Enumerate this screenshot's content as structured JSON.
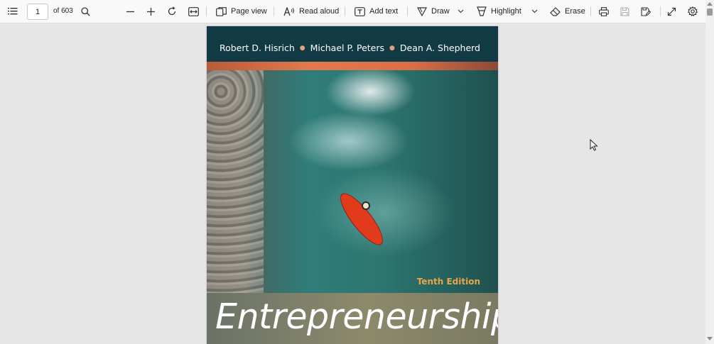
{
  "toolbar": {
    "page_number": "1",
    "page_total": "of 603",
    "page_view": "Page view",
    "read_aloud": "Read aloud",
    "add_text": "Add text",
    "draw": "Draw",
    "highlight": "Highlight",
    "erase": "Erase"
  },
  "document": {
    "authors": [
      "Robert D. Hisrich",
      "Michael P. Peters",
      "Dean A. Shepherd"
    ],
    "edition": "Tenth Edition",
    "title": "Entrepreneurship"
  },
  "icons": [
    "contents-icon",
    "search-icon",
    "zoom-out-icon",
    "zoom-in-icon",
    "rotate-icon",
    "fit-page-icon",
    "page-view-icon",
    "read-aloud-icon",
    "add-text-icon",
    "draw-icon",
    "highlight-icon",
    "erase-icon",
    "print-icon",
    "save-icon",
    "save-as-icon",
    "fullscreen-icon",
    "settings-icon"
  ]
}
